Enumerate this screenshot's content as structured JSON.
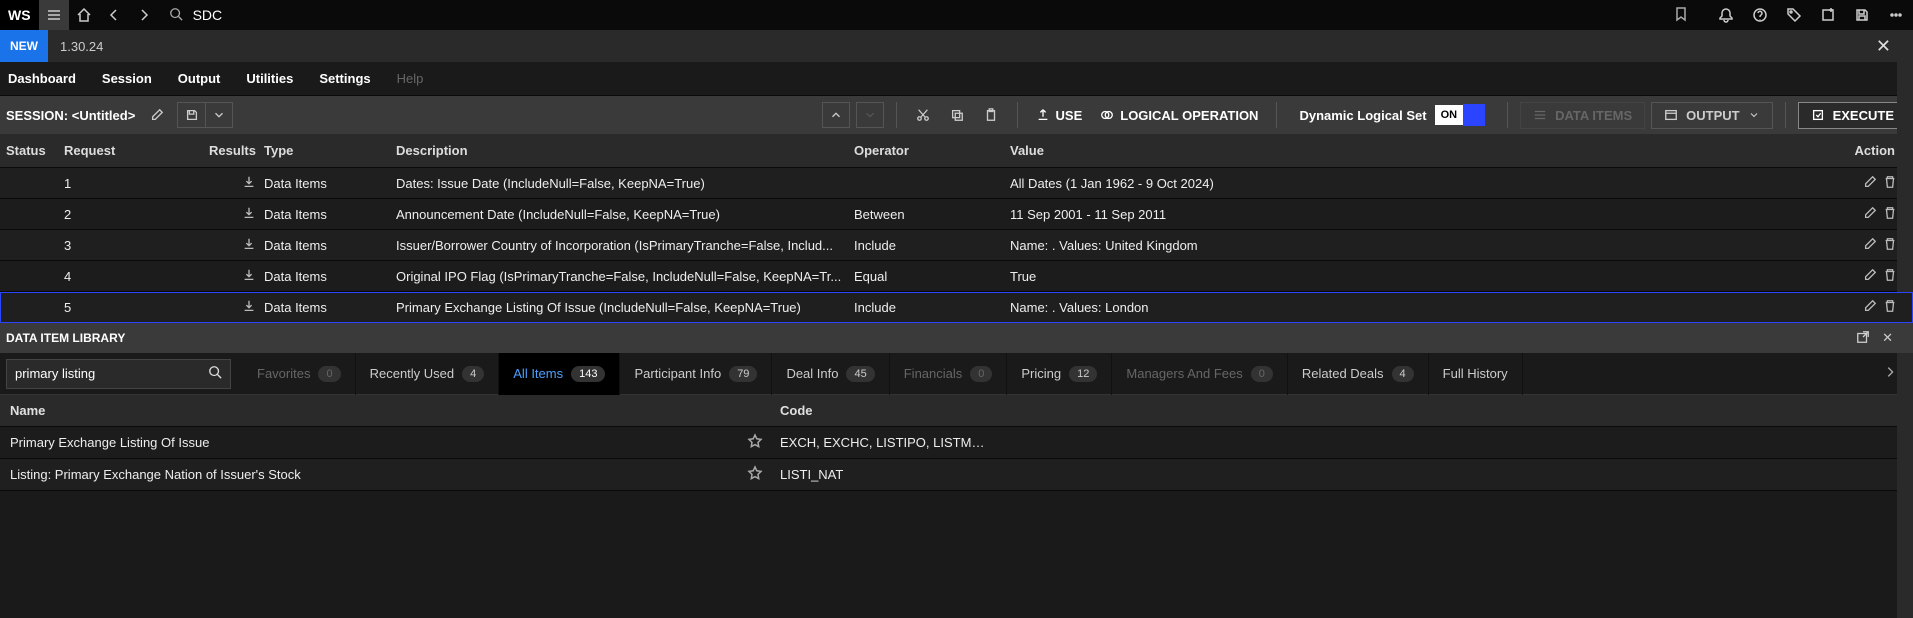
{
  "app": {
    "logo": "WS",
    "search_value": "SDC"
  },
  "newbar": {
    "new": "NEW",
    "version": "1.30.24"
  },
  "menus": [
    "Dashboard",
    "Session",
    "Output",
    "Utilities",
    "Settings",
    "Help"
  ],
  "session": {
    "label": "SESSION: <Untitled>",
    "use": "USE",
    "logical_op": "LOGICAL OPERATION",
    "dls_label": "Dynamic Logical Set",
    "dls_on": "ON",
    "data_items": "DATA ITEMS",
    "output": "OUTPUT",
    "execute": "EXECUTE"
  },
  "grid": {
    "headers": {
      "status": "Status",
      "request": "Request",
      "results": "Results",
      "type": "Type",
      "description": "Description",
      "operator": "Operator",
      "value": "Value",
      "action": "Action"
    },
    "rows": [
      {
        "request": "1",
        "type": "Data Items",
        "description": "Dates: Issue Date (IncludeNull=False, KeepNA=True)",
        "operator": "",
        "value": "All Dates (1 Jan 1962 - 9 Oct 2024)"
      },
      {
        "request": "2",
        "type": "Data Items",
        "description": "Announcement Date (IncludeNull=False, KeepNA=True)",
        "operator": "Between",
        "value": "11 Sep 2001 - 11 Sep 2011"
      },
      {
        "request": "3",
        "type": "Data Items",
        "description": "Issuer/Borrower Country of Incorporation (IsPrimaryTranche=False, Includ...",
        "operator": "Include",
        "value": "Name: <Untitled>. Values: United Kingdom"
      },
      {
        "request": "4",
        "type": "Data Items",
        "description": "Original IPO Flag (IsPrimaryTranche=False, IncludeNull=False, KeepNA=Tr...",
        "operator": "Equal",
        "value": "True"
      },
      {
        "request": "5",
        "type": "Data Items",
        "description": "Primary Exchange Listing Of Issue (IncludeNull=False, KeepNA=True)",
        "operator": "Include",
        "value": "Name: <Untitled>. Values: London"
      }
    ]
  },
  "library": {
    "title": "DATA ITEM LIBRARY",
    "search_value": "primary listing",
    "tabs": [
      {
        "label": "Favorites",
        "count": "0",
        "state": "disabled"
      },
      {
        "label": "Recently Used",
        "count": "4",
        "state": ""
      },
      {
        "label": "All Items",
        "count": "143",
        "state": "active"
      },
      {
        "label": "Participant Info",
        "count": "79",
        "state": ""
      },
      {
        "label": "Deal Info",
        "count": "45",
        "state": ""
      },
      {
        "label": "Financials",
        "count": "0",
        "state": "disabled"
      },
      {
        "label": "Pricing",
        "count": "12",
        "state": ""
      },
      {
        "label": "Managers And Fees",
        "count": "0",
        "state": "disabled"
      },
      {
        "label": "Related Deals",
        "count": "4",
        "state": ""
      },
      {
        "label": "Full History",
        "count": "",
        "state": ""
      }
    ],
    "headers": {
      "name": "Name",
      "code": "Code"
    },
    "rows": [
      {
        "name": "Primary Exchange Listing Of Issue",
        "code": "EXCH, EXCHC, LISTIPO, LISTM, S..."
      },
      {
        "name": "Listing: Primary Exchange Nation of Issuer's Stock",
        "code": "LISTI_NAT"
      }
    ]
  }
}
